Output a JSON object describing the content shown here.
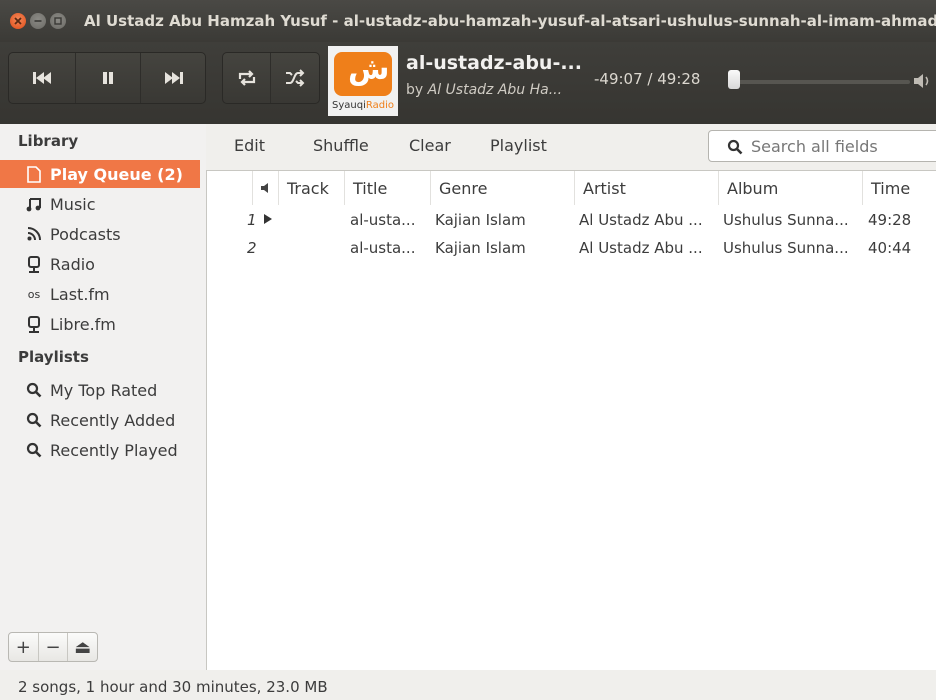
{
  "window": {
    "title": "Al Ustadz Abu Hamzah Yusuf - al-ustadz-abu-hamzah-yusuf-al-atsari-ushulus-sunnah-al-imam-ahmad"
  },
  "player": {
    "now_playing_title": "al-ustadz-abu-...",
    "by_prefix": "by",
    "artist": "Al Ustadz Abu Ha...",
    "time": "-49:07 / 49:28",
    "art_text": "Syauqi",
    "art_text2": "Radio",
    "art_glyph": "ش",
    "progress_fraction": 0.01
  },
  "sidebar": {
    "library_title": "Library",
    "library_items": [
      {
        "label": "Play Queue (2)",
        "icon": "document-icon"
      },
      {
        "label": "Music",
        "icon": "music-icon"
      },
      {
        "label": "Podcasts",
        "icon": "podcast-icon"
      },
      {
        "label": "Radio",
        "icon": "radio-icon"
      },
      {
        "label": "Last.fm",
        "icon": "lastfm-icon"
      },
      {
        "label": "Libre.fm",
        "icon": "radio-icon"
      }
    ],
    "playlists_title": "Playlists",
    "playlist_items": [
      {
        "label": "My Top Rated",
        "icon": "search-icon"
      },
      {
        "label": "Recently Added",
        "icon": "search-icon"
      },
      {
        "label": "Recently Played",
        "icon": "search-icon"
      }
    ],
    "tools": [
      "+",
      "−",
      "⏏"
    ]
  },
  "toolbar": {
    "edit": "Edit",
    "shuffle": "Shuffle",
    "clear": "Clear",
    "playlist": "Playlist",
    "search_placeholder": "Search all fields"
  },
  "table": {
    "headers": {
      "track": "Track",
      "title": "Title",
      "genre": "Genre",
      "artist": "Artist",
      "album": "Album",
      "time": "Time"
    },
    "rows": [
      {
        "num": "1",
        "playing": true,
        "title": "al-usta...",
        "genre": "Kajian Islam",
        "artist": "Al Ustadz Abu ...",
        "album": "Ushulus Sunna...",
        "time": "49:28"
      },
      {
        "num": "2",
        "playing": false,
        "title": "al-usta...",
        "genre": "Kajian Islam",
        "artist": "Al Ustadz Abu ...",
        "album": "Ushulus Sunna...",
        "time": "40:44"
      }
    ]
  },
  "status": "2 songs, 1 hour and 30 minutes, 23.0 MB"
}
